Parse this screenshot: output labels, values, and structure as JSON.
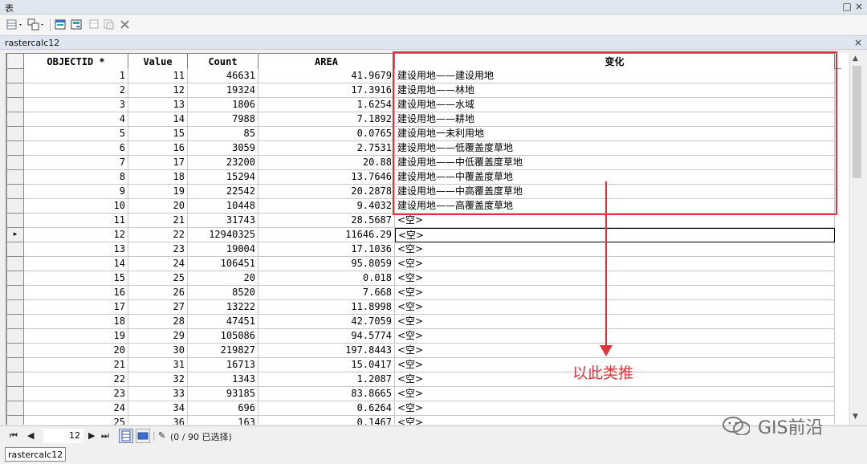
{
  "window": {
    "title": "表",
    "restore_label": "□",
    "close_label": "×"
  },
  "toolbar": {
    "icons": [
      "table-options-icon",
      "related-tables-icon",
      "select-by-attributes-icon",
      "switch-selection-icon",
      "clear-selection-icon",
      "zoom-to-selected-icon",
      "delete-selected-icon"
    ]
  },
  "tab": {
    "name": "rastercalc12",
    "close_label": "×"
  },
  "table": {
    "columns": [
      "OBJECTID *",
      "Value",
      "Count",
      "AREA",
      "变化"
    ],
    "rows": [
      [
        "1",
        "11",
        "46631",
        "41.9679",
        "建设用地——建设用地"
      ],
      [
        "2",
        "12",
        "19324",
        "17.3916",
        "建设用地——林地"
      ],
      [
        "3",
        "13",
        "1806",
        "1.6254",
        "建设用地——水域"
      ],
      [
        "4",
        "14",
        "7988",
        "7.1892",
        "建设用地——耕地"
      ],
      [
        "5",
        "15",
        "85",
        "0.0765",
        "建设用地一未利用地"
      ],
      [
        "6",
        "16",
        "3059",
        "2.7531",
        "建设用地——低覆盖度草地"
      ],
      [
        "7",
        "17",
        "23200",
        "20.88",
        "建设用地——中低覆盖度草地"
      ],
      [
        "8",
        "18",
        "15294",
        "13.7646",
        "建设用地——中覆盖度草地"
      ],
      [
        "9",
        "19",
        "22542",
        "20.2878",
        "建设用地——中高覆盖度草地"
      ],
      [
        "10",
        "20",
        "10448",
        "9.4032",
        "建设用地——高覆盖度草地"
      ],
      [
        "11",
        "21",
        "31743",
        "28.5687",
        "<空>"
      ],
      [
        "12",
        "22",
        "12940325",
        "11646.29",
        "<空>"
      ],
      [
        "13",
        "23",
        "19004",
        "17.1036",
        "<空>"
      ],
      [
        "14",
        "24",
        "106451",
        "95.8059",
        "<空>"
      ],
      [
        "15",
        "25",
        "20",
        "0.018",
        "<空>"
      ],
      [
        "16",
        "26",
        "8520",
        "7.668",
        "<空>"
      ],
      [
        "17",
        "27",
        "13222",
        "11.8998",
        "<空>"
      ],
      [
        "18",
        "28",
        "47451",
        "42.7059",
        "<空>"
      ],
      [
        "19",
        "29",
        "105086",
        "94.5774",
        "<空>"
      ],
      [
        "20",
        "30",
        "219827",
        "197.8443",
        "<空>"
      ],
      [
        "21",
        "31",
        "16713",
        "15.0417",
        "<空>"
      ],
      [
        "22",
        "32",
        "1343",
        "1.2087",
        "<空>"
      ],
      [
        "23",
        "33",
        "93185",
        "83.8665",
        "<空>"
      ],
      [
        "24",
        "34",
        "696",
        "0.6264",
        "<空>"
      ],
      [
        "25",
        "36",
        "163",
        "0.1467",
        "<空>"
      ]
    ],
    "current_row_index": 11
  },
  "annotation": {
    "text": "以此类推",
    "color": "#e2343b"
  },
  "navigation": {
    "current_record": "12",
    "selection_status": "(0 / 90 已选择)"
  },
  "watermark": {
    "text": "GIS前沿"
  },
  "status_tab": {
    "name": "rastercalc12"
  }
}
